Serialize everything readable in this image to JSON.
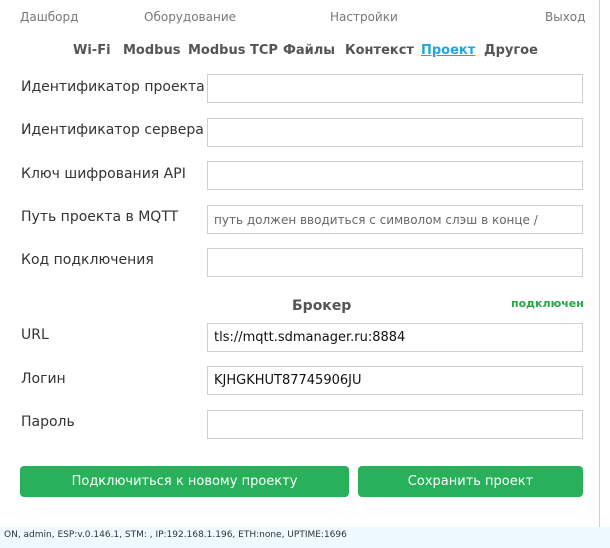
{
  "topnav": {
    "items": [
      "Дашборд",
      "Оборудование",
      "Настройки",
      "Выход"
    ]
  },
  "subnav": {
    "items": [
      "Wi-Fi",
      "Modbus",
      "Modbus TCP",
      "Файлы",
      "Контекст",
      "Проект",
      "Другое"
    ],
    "active": "Проект"
  },
  "form": {
    "project_id": {
      "label": "Идентификатор проекта",
      "value": ""
    },
    "server_id": {
      "label": "Идентификатор сервера",
      "value": ""
    },
    "api_key": {
      "label": "Ключ шифрования API",
      "value": ""
    },
    "mqtt_path": {
      "label": "Путь проекта в MQTT",
      "value": "",
      "placeholder": "путь должен вводиться с символом слэш в конце /"
    },
    "connection_code": {
      "label": "Код подключения",
      "value": ""
    }
  },
  "broker": {
    "title": "Брокер",
    "status": "подключен",
    "status_color": "#28a745",
    "url": {
      "label": "URL",
      "value": "tls://mqtt.sdmanager.ru:8884"
    },
    "login": {
      "label": "Логин",
      "value": "KJHGKHUT87745906JU"
    },
    "password": {
      "label": "Пароль",
      "value": ""
    }
  },
  "buttons": {
    "connect": "Подключиться к новому проекту",
    "save": "Сохранить проект",
    "color": "#28b05a"
  },
  "footer": {
    "status": "ON, admin, ESP:v.0.146.1, STM:          , IP:192.168.1.196, ETH:none, UPTIME:1696"
  }
}
